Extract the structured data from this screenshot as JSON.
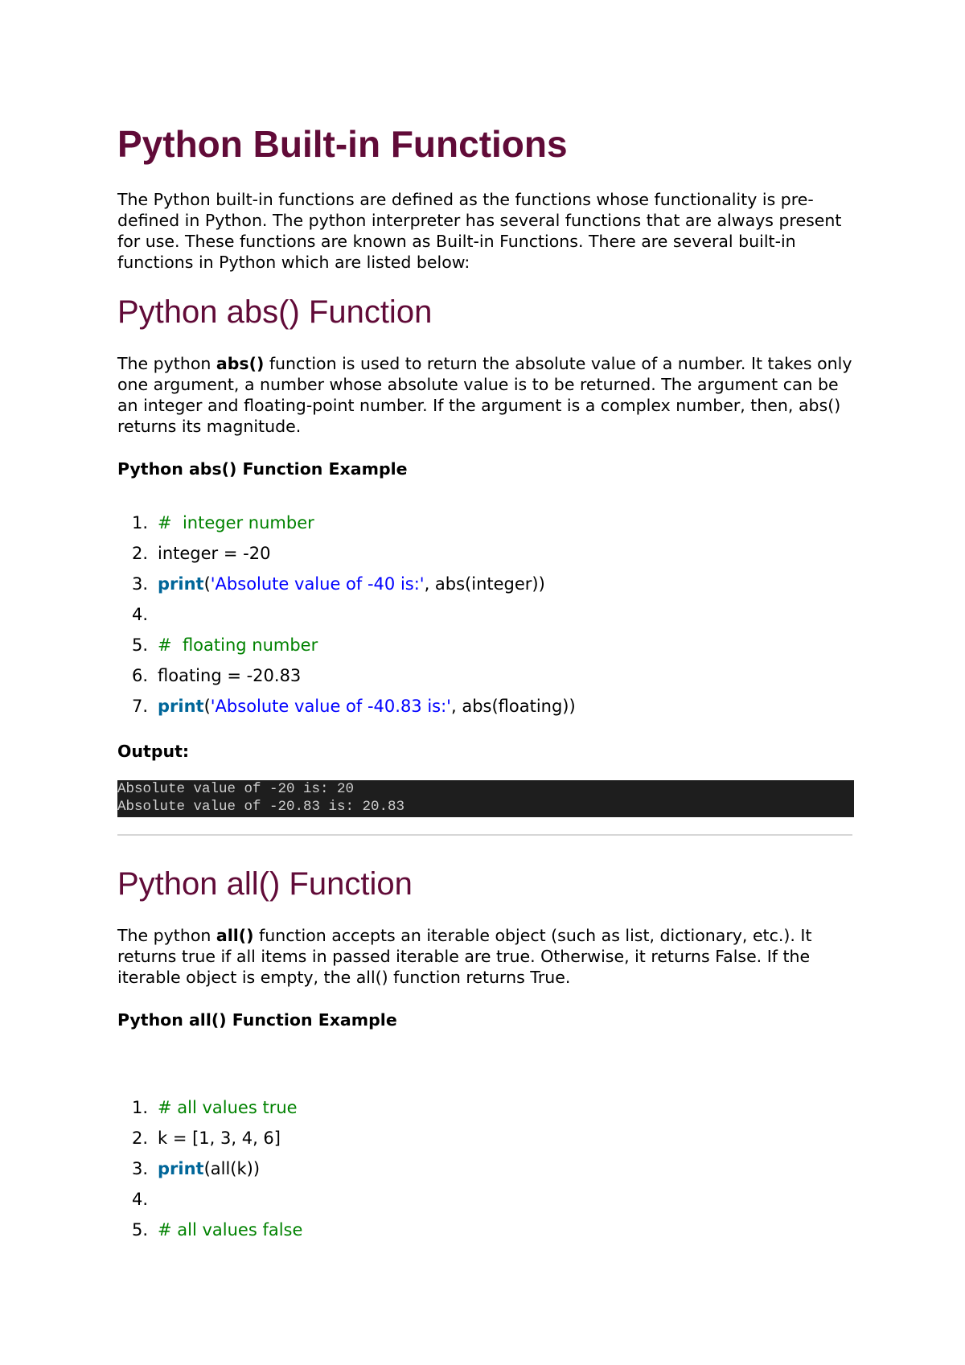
{
  "title": "Python Built-in Functions",
  "intro": "The Python built-in functions are defined as the functions whose functionality is pre-defined in Python. The python interpreter has several functions that are always present for use. These functions are known as Built-in Functions. There are several built-in functions in Python which are listed below:",
  "sections": [
    {
      "heading": "Python abs() Function",
      "desc_prefix": "The python ",
      "desc_bold": "abs()",
      "desc_suffix": " function is used to return the absolute value of a number. It takes only one argument, a number whose absolute value is to be returned. The argument can be an integer and floating-point number. If the argument is a complex number, then, abs() returns its magnitude.",
      "example_heading": "Python abs() Function Example",
      "code": [
        {
          "num": "1.",
          "parts": [
            {
              "t": "cmt",
              "text": "#  integer number"
            }
          ]
        },
        {
          "num": "2.",
          "parts": [
            {
              "t": "plain",
              "text": "integer = -20"
            }
          ]
        },
        {
          "num": "3.",
          "parts": [
            {
              "t": "kw",
              "text": "print"
            },
            {
              "t": "plain",
              "text": "("
            },
            {
              "t": "str",
              "text": "'Absolute value of -40 is:'"
            },
            {
              "t": "plain",
              "text": ", abs(integer))"
            }
          ]
        },
        {
          "num": "4.",
          "parts": []
        },
        {
          "num": "5.",
          "parts": [
            {
              "t": "cmt",
              "text": "#  floating number"
            }
          ]
        },
        {
          "num": "6.",
          "parts": [
            {
              "t": "plain",
              "text": "floating = -20.83"
            }
          ]
        },
        {
          "num": "7.",
          "parts": [
            {
              "t": "kw",
              "text": "print"
            },
            {
              "t": "plain",
              "text": "("
            },
            {
              "t": "str",
              "text": "'Absolute value of -40.83 is:'"
            },
            {
              "t": "plain",
              "text": ", abs(floating))"
            }
          ]
        }
      ],
      "output_label": "Output:",
      "output_lines": [
        "Absolute value of -20 is: 20",
        "Absolute value of -20.83 is: 20.83"
      ]
    },
    {
      "heading": "Python all() Function",
      "desc_prefix": "The python ",
      "desc_bold": "all()",
      "desc_suffix": " function accepts an iterable object (such as list, dictionary, etc.). It returns true if all items in passed iterable are true. Otherwise, it returns False. If the iterable object is empty, the all() function returns True.",
      "example_heading": "Python all() Function Example",
      "code": [
        {
          "num": "1.",
          "parts": [
            {
              "t": "cmt",
              "text": "# all values true"
            }
          ]
        },
        {
          "num": "2.",
          "parts": [
            {
              "t": "plain",
              "text": "k = [1, 3, 4, 6]"
            }
          ]
        },
        {
          "num": "3.",
          "parts": [
            {
              "t": "kw",
              "text": "print"
            },
            {
              "t": "plain",
              "text": "(all(k))"
            }
          ]
        },
        {
          "num": "4.",
          "parts": []
        },
        {
          "num": "5.",
          "parts": [
            {
              "t": "cmt",
              "text": "# all values false"
            }
          ]
        }
      ]
    }
  ]
}
